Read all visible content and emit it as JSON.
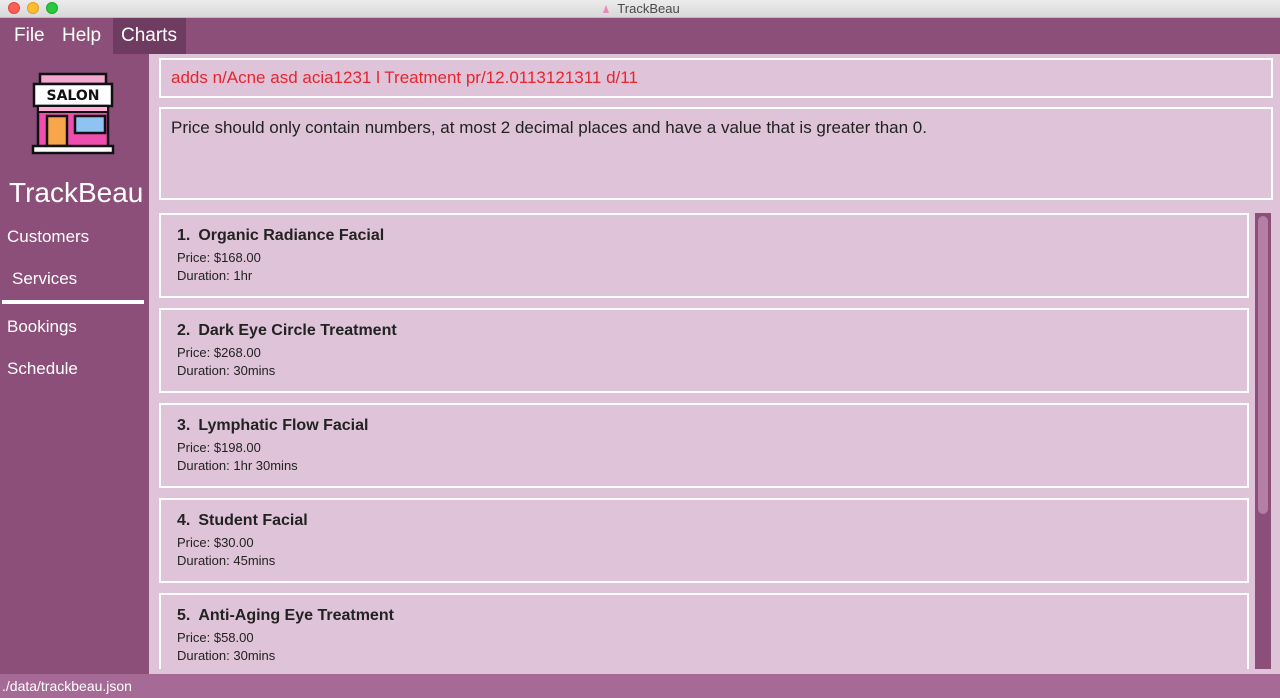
{
  "window": {
    "title": "TrackBeau"
  },
  "menu": {
    "file": "File",
    "help": "Help",
    "charts": "Charts"
  },
  "sidebar": {
    "logo_text": "SALON",
    "brand": "TrackBeau",
    "nav": {
      "customers": "Customers",
      "services": "Services",
      "bookings": "Bookings",
      "schedule": "Schedule"
    },
    "active": "services"
  },
  "command": {
    "text": "adds n/Acne asd acia1231 l Treatment pr/12.0113121311 d/11"
  },
  "result": {
    "text": "Price should only contain numbers, at most 2 decimal places and have a value that is greater than 0."
  },
  "services": [
    {
      "index": "1.",
      "name": "Organic Radiance Facial",
      "price": "Price: $168.00",
      "duration": "Duration: 1hr"
    },
    {
      "index": "2.",
      "name": "Dark Eye Circle Treatment",
      "price": "Price: $268.00",
      "duration": "Duration:  30mins"
    },
    {
      "index": "3.",
      "name": "Lymphatic Flow Facial",
      "price": "Price: $198.00",
      "duration": "Duration: 1hr 30mins"
    },
    {
      "index": "4.",
      "name": "Student Facial",
      "price": "Price: $30.00",
      "duration": "Duration:  45mins"
    },
    {
      "index": "5.",
      "name": "Anti-Aging Eye Treatment",
      "price": "Price: $58.00",
      "duration": "Duration:  30mins"
    }
  ],
  "status": {
    "path": "./data/trackbeau.json"
  },
  "colors": {
    "primary": "#8b4f7a",
    "panel": "#dfc3d8",
    "error_text": "#e8242e"
  }
}
